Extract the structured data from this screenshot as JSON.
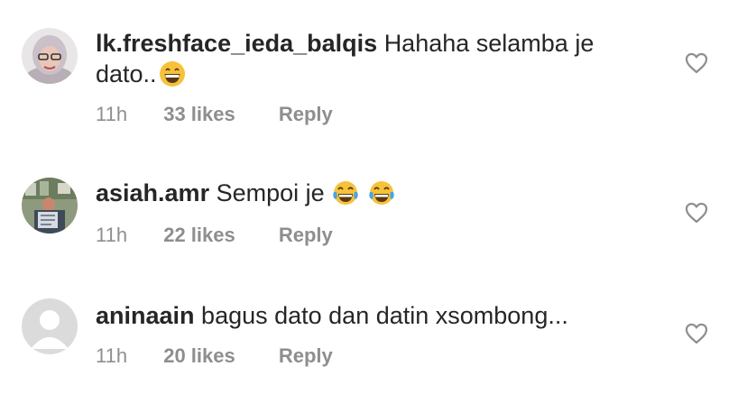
{
  "comments": [
    {
      "username": "lk.freshface_ieda_balqis",
      "text_line1": "Hahaha selamba je",
      "text_line2": "dato..",
      "emojis": [
        "grinning-face-emoji"
      ],
      "time": "11h",
      "likes": "33 likes",
      "reply": "Reply",
      "avatar": "profile-photo"
    },
    {
      "username": "asiah.amr",
      "text_line1": "Sempoi je",
      "emojis": [
        "tears-of-joy-emoji",
        "tears-of-joy-emoji"
      ],
      "time": "11h",
      "likes": "22 likes",
      "reply": "Reply",
      "avatar": "profile-photo"
    },
    {
      "username": "aninaain",
      "text_line1": "bagus dato dan datin xsombong...",
      "emojis": [],
      "time": "11h",
      "likes": "20 likes",
      "reply": "Reply",
      "avatar": "default-avatar"
    }
  ],
  "icons": {
    "like": "heart-outline-icon"
  },
  "colors": {
    "text": "#262626",
    "meta": "#8e8e8e",
    "heart_stroke": "#8e8e8e",
    "default_avatar_bg": "#dbdbdb"
  }
}
